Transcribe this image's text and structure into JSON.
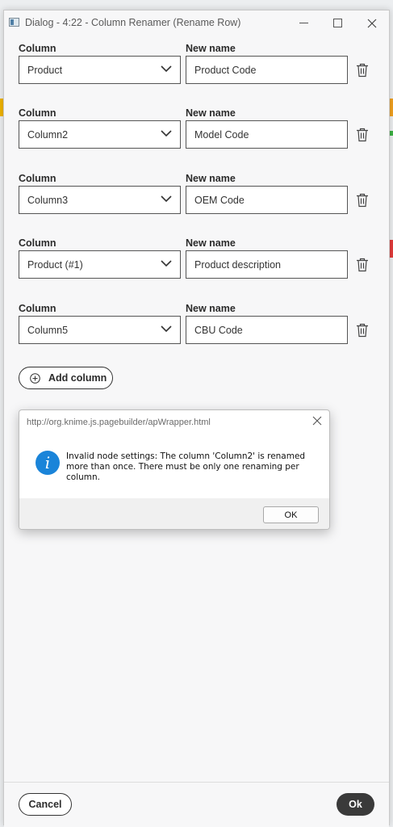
{
  "window": {
    "title": "Dialog - 4:22 - Column Renamer (Rename Row)"
  },
  "labels": {
    "column": "Column",
    "new_name": "New name"
  },
  "rows": [
    {
      "column": "Product",
      "new_name": "Product Code"
    },
    {
      "column": "Column2",
      "new_name": "Model Code"
    },
    {
      "column": "Column3",
      "new_name": "OEM Code"
    },
    {
      "column": "Product (#1)",
      "new_name": "Product description"
    },
    {
      "column": "Column5",
      "new_name": "CBU Code"
    }
  ],
  "add_column_label": "Add column",
  "footer": {
    "cancel_label": "Cancel",
    "ok_label": "Ok"
  },
  "alert": {
    "title": "http://org.knime.js.pagebuilder/apWrapper.html",
    "message": "Invalid node settings: The column 'Column2' is renamed more than once. There must be only one renaming per column.",
    "ok_label": "OK",
    "icon": "info-icon"
  },
  "colors": {
    "accent_dark": "#3a3a3a",
    "info_blue": "#1a84d9"
  }
}
